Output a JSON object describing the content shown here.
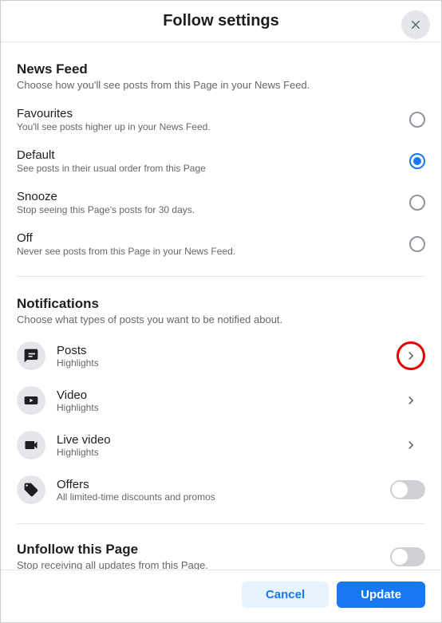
{
  "header": {
    "title": "Follow settings"
  },
  "newsFeed": {
    "title": "News Feed",
    "subtitle": "Choose how you'll see posts from this Page in your News Feed.",
    "options": [
      {
        "title": "Favourites",
        "desc": "You'll see posts higher up in your News Feed.",
        "selected": false
      },
      {
        "title": "Default",
        "desc": "See posts in their usual order from this Page",
        "selected": true
      },
      {
        "title": "Snooze",
        "desc": "Stop seeing this Page's posts for 30 days.",
        "selected": false
      },
      {
        "title": "Off",
        "desc": "Never see posts from this Page in your News Feed.",
        "selected": false
      }
    ]
  },
  "notifications": {
    "title": "Notifications",
    "subtitle": "Choose what types of posts you want to be notified about.",
    "items": [
      {
        "title": "Posts",
        "sub": "Highlights",
        "type": "chevron",
        "highlighted": true
      },
      {
        "title": "Video",
        "sub": "Highlights",
        "type": "chevron",
        "highlighted": false
      },
      {
        "title": "Live video",
        "sub": "Highlights",
        "type": "chevron",
        "highlighted": false
      },
      {
        "title": "Offers",
        "sub": "All limited-time discounts and promos",
        "type": "toggle",
        "highlighted": false
      }
    ]
  },
  "unfollow": {
    "title": "Unfollow this Page",
    "subtitle": "Stop receiving all updates from this Page."
  },
  "footer": {
    "cancel": "Cancel",
    "update": "Update"
  }
}
